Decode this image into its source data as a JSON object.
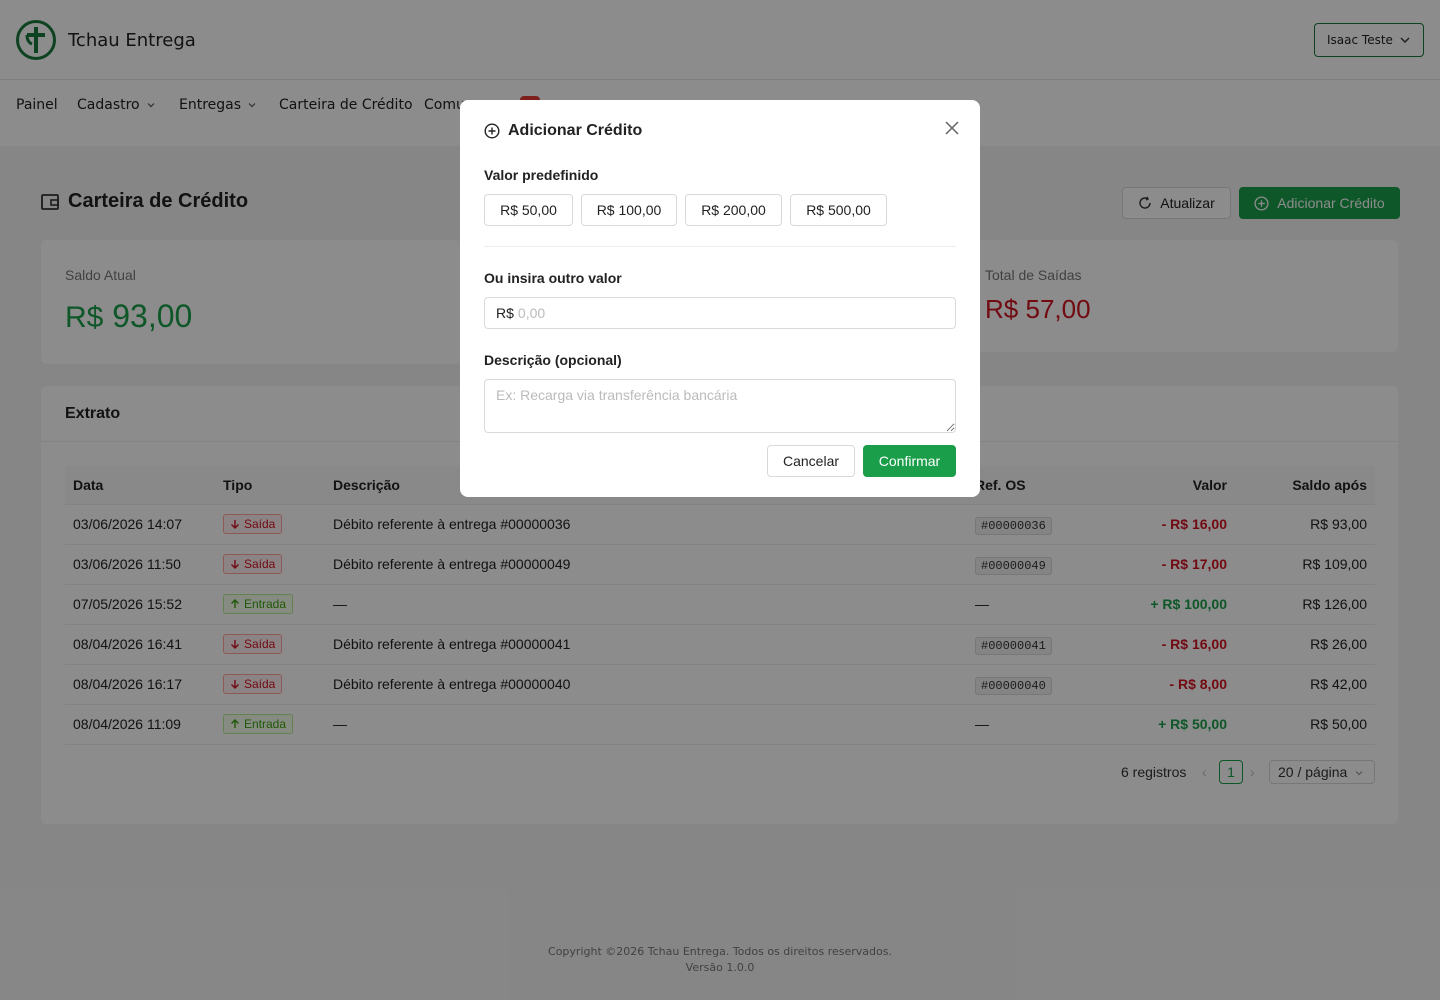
{
  "app": {
    "brand": "Tchau Entrega",
    "user": "Isaac Teste"
  },
  "nav": {
    "items": [
      {
        "label": "Painel"
      },
      {
        "label": "Cadastro"
      },
      {
        "label": "Entregas"
      },
      {
        "label": "Carteira de Crédito"
      },
      {
        "label": "Comu"
      }
    ]
  },
  "page": {
    "title": "Carteira de Crédito",
    "refresh_label": "Atualizar",
    "add_label": "Adicionar Crédito"
  },
  "stats": {
    "balance_label": "Saldo Atual",
    "balance_currency": "R$",
    "balance_value": "93,00",
    "out_label": "Total de Saídas",
    "out_currency": "R$",
    "out_value": "57,00"
  },
  "extrato": {
    "title": "Extrato",
    "columns": [
      "Data",
      "Tipo",
      "Descrição",
      "Ref. OS",
      "Valor",
      "Saldo após"
    ],
    "rows": [
      {
        "date": "03/06/2026 14:07",
        "type": "Saída",
        "kind": "out",
        "desc": "Débito referente à entrega #00000036",
        "ref": "#00000036",
        "value": "- R$ 16,00",
        "balance": "R$ 93,00"
      },
      {
        "date": "03/06/2026 11:50",
        "type": "Saída",
        "kind": "out",
        "desc": "Débito referente à entrega #00000049",
        "ref": "#00000049",
        "value": "- R$ 17,00",
        "balance": "R$ 109,00"
      },
      {
        "date": "07/05/2026 15:52",
        "type": "Entrada",
        "kind": "in",
        "desc": "—",
        "ref": "—",
        "value": "+ R$ 100,00",
        "balance": "R$ 126,00"
      },
      {
        "date": "08/04/2026 16:41",
        "type": "Saída",
        "kind": "out",
        "desc": "Débito referente à entrega #00000041",
        "ref": "#00000041",
        "value": "- R$ 16,00",
        "balance": "R$ 26,00"
      },
      {
        "date": "08/04/2026 16:17",
        "type": "Saída",
        "kind": "out",
        "desc": "Débito referente à entrega #00000040",
        "ref": "#00000040",
        "value": "- R$ 8,00",
        "balance": "R$ 42,00"
      },
      {
        "date": "08/04/2026 11:09",
        "type": "Entrada",
        "kind": "in",
        "desc": "—",
        "ref": "—",
        "value": "+ R$ 50,00",
        "balance": "R$ 50,00"
      }
    ],
    "total": "6 registros",
    "page": "1",
    "page_size": "20 / página"
  },
  "footer": {
    "copyright": "Copyright ©2026 Tchau Entrega. Todos os direitos reservados.",
    "version": "Versão 1.0.0"
  },
  "modal": {
    "title": "Adicionar Crédito",
    "preset_label": "Valor predefinido",
    "presets": [
      "R$ 50,00",
      "R$ 100,00",
      "R$ 200,00",
      "R$ 500,00"
    ],
    "custom_label": "Ou insira outro valor",
    "currency_prefix": "R$",
    "amount_placeholder": "0,00",
    "desc_label": "Descrição (opcional)",
    "desc_placeholder": "Ex: Recarga via transferência bancária",
    "cancel": "Cancelar",
    "confirm": "Confirmar"
  },
  "colors": {
    "brand": "#1a9e4a",
    "negative": "#cf1322",
    "positive": "#1a9e4a"
  }
}
